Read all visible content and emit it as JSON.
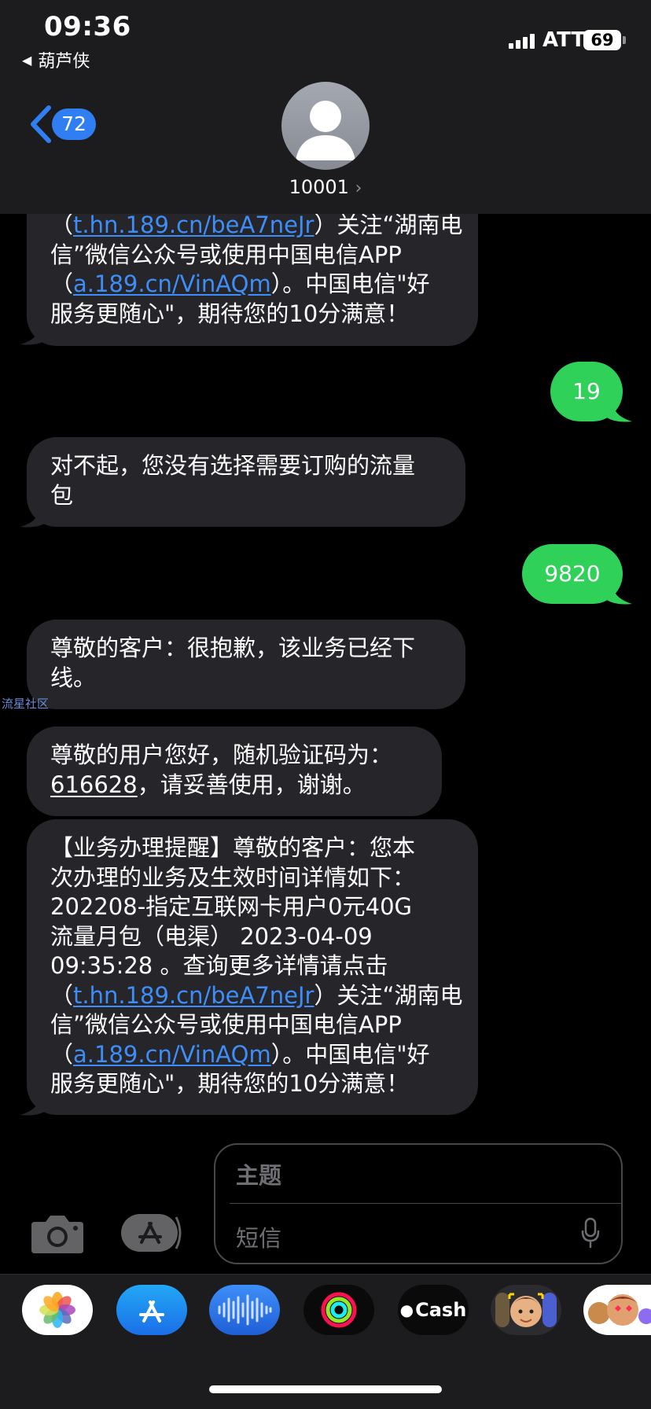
{
  "status_bar": {
    "time": "09:36",
    "back_app": "葫芦侠",
    "carrier": "ATT",
    "battery": "69"
  },
  "header": {
    "unread_badge": "72",
    "contact_name": "10001",
    "contact_chevron": "›"
  },
  "messages": {
    "m1": {
      "l1_pre": "（",
      "l1_link": "t.hn.189.cn/beA7neJr",
      "l1_post": "）关注“湖南电",
      "l2": "信”微信公众号或使用中国电信APP",
      "l3_pre": "（",
      "l3_link": "a.189.cn/VinAQm",
      "l3_post": "）。中国电信\"好",
      "l4": "服务更随心\"，期待您的10分满意！"
    },
    "m2": {
      "text": "19"
    },
    "m3": {
      "l1": "对不起，您没有选择需要订购的流量",
      "l2": "包"
    },
    "m4": {
      "text": "9820"
    },
    "m5": {
      "l1": "尊敬的客户：很抱歉，该业务已经下",
      "l2": "线。"
    },
    "m6": {
      "l1": "尊敬的用户您好，随机验证码为：",
      "l2_code": "616628",
      "l2_post": "，请妥善使用，谢谢。"
    },
    "m7": {
      "l1": "【业务办理提醒】尊敬的客户：您本",
      "l2": "次办理的业务及生效时间详情如下：",
      "l3": "202208-指定互联网卡用户0元40G",
      "l4": "流量月包（电渠） 2023-04-09",
      "l5": "09:35:28 。查询更多详情请点击",
      "l6_pre": "（",
      "l6_link": "t.hn.189.cn/beA7neJr",
      "l6_post": "）关注“湖南电",
      "l7": "信”微信公众号或使用中国电信APP",
      "l8_pre": "（",
      "l8_link": "a.189.cn/VinAQm",
      "l8_post": "）。中国电信\"好",
      "l9": "服务更随心\"，期待您的10分满意！"
    }
  },
  "watermark": "流星社区",
  "compose": {
    "subject_placeholder": "主题",
    "message_placeholder": "短信"
  },
  "app_drawer": {
    "apps": [
      "photos-icon",
      "app-store-icon",
      "audio-message-icon",
      "activity-icon",
      "apple-cash-icon",
      "memoji-icon",
      "animoji-icon"
    ],
    "cash_label": "Cash"
  },
  "colors": {
    "incoming_bubble": "#26252a",
    "outgoing_bubble": "#30d158",
    "link": "#3d8ef8",
    "accent": "#2f7ff3"
  }
}
